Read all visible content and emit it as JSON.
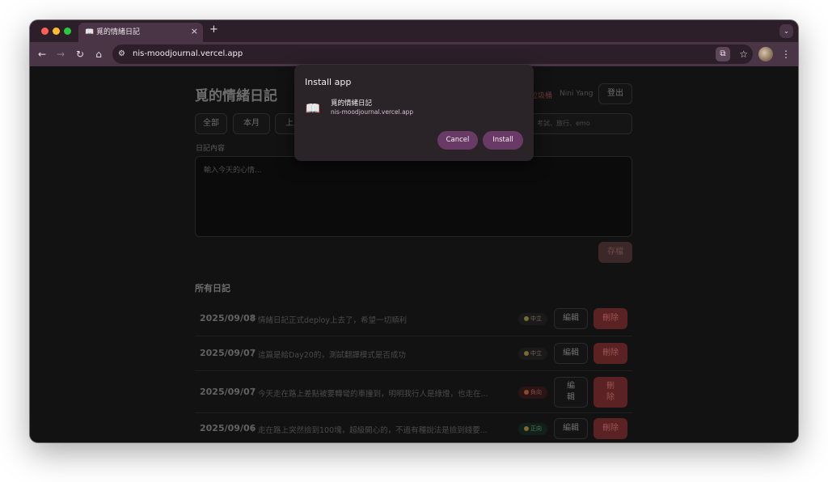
{
  "browser": {
    "tab_title": "覓的情緒日記",
    "tab_favicon": "📖",
    "tab_close": "×",
    "new_tab": "+",
    "tab_menu": "⌄",
    "url": "nis-moodjournal.vercel.app",
    "site_icon": "⚙",
    "install_icon": "⧉",
    "star_icon": "☆",
    "menu_icon": "⋮",
    "back": "←",
    "forward": "→",
    "reload": "↻",
    "home": "⌂"
  },
  "app": {
    "title": "覓的情緒日記",
    "header_link": "垃圾桶",
    "user_name": "Nini Yang",
    "logout_label": "登出",
    "filters": [
      "全部",
      "本月",
      "上月"
    ],
    "search_placeholder": "考試、旅行、emo",
    "content_label": "日記內容",
    "textarea_placeholder": "輸入今天的心情...",
    "save_label": "存檔",
    "section_title": "所有日記",
    "separator": "|",
    "entries": [
      {
        "date": "2025/09/08",
        "text": "情緒日記正式deploy上去了，希望一切順利",
        "badge": "中立",
        "mood": "neutral",
        "edit": "編輯",
        "delete": "刪除"
      },
      {
        "date": "2025/09/07",
        "text": "這篇是給Day20的，測試翻譯模式是否成功",
        "badge": "中立",
        "mood": "neutral",
        "edit": "編輯",
        "delete": "刪除"
      },
      {
        "date": "2025/09/07",
        "text": "今天走在路上差點被要轉彎的車撞到，明明我行人是綠燈，也走在...",
        "badge": "負向",
        "mood": "negative",
        "edit": "編輯",
        "delete": "刪除"
      },
      {
        "date": "2025/09/06",
        "text": "走在路上突然撿到100塊，超級開心的，不過有種說法是撿到錢要...",
        "badge": "正向",
        "mood": "positive",
        "edit": "編輯",
        "delete": "刪除"
      }
    ]
  },
  "install_dialog": {
    "title": "Install app",
    "app_icon": "📖",
    "app_name": "覓的情緒日記",
    "app_url": "nis-moodjournal.vercel.app",
    "cancel_label": "Cancel",
    "install_label": "Install"
  }
}
